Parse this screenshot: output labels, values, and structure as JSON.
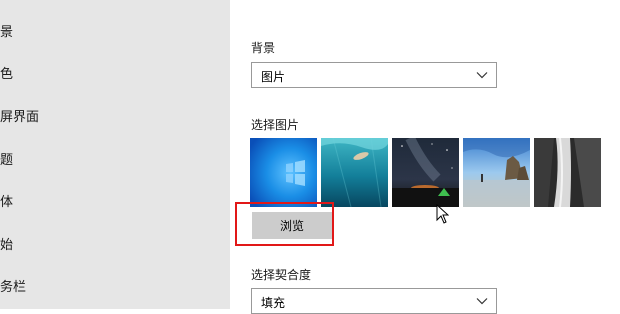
{
  "sidebar": {
    "items": [
      {
        "label": "景"
      },
      {
        "label": "色"
      },
      {
        "label": "屏界面"
      },
      {
        "label": "题"
      },
      {
        "label": "体"
      },
      {
        "label": "始"
      },
      {
        "label": "务栏"
      }
    ]
  },
  "main": {
    "background_label": "背景",
    "background_value": "图片",
    "choose_picture_label": "选择图片",
    "browse_label": "浏览",
    "fit_label": "选择契合度",
    "fit_value": "填充"
  },
  "thumbnails": [
    {
      "name": "windows-default"
    },
    {
      "name": "underwater-swimmer"
    },
    {
      "name": "night-sky-tent"
    },
    {
      "name": "beach-rocks"
    },
    {
      "name": "waterfall-cliff"
    }
  ],
  "colors": {
    "sidebar_bg": "#e6e6e6",
    "highlight": "#e11818",
    "button_bg": "#cccccc"
  }
}
